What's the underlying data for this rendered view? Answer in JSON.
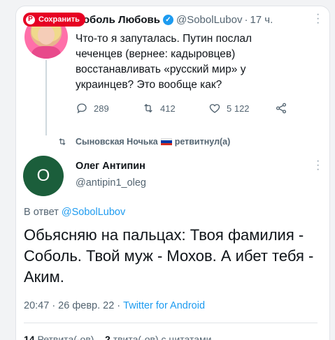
{
  "pin_button": {
    "label": "Сохранить",
    "icon": "pinterest-icon"
  },
  "tweet1": {
    "name": "Соболь Любовь",
    "handle": "@SobolLubov",
    "separator": "·",
    "time": "17 ч.",
    "text": "Что-то я запуталась. Путин послал чеченцев (вернее: кадыровцев) восстанавливать «русский мир» у украинцев? Это вообще как?",
    "replies": "289",
    "retweets": "412",
    "likes": "5 122"
  },
  "retweet_notice": {
    "user": "Сыновская Ночька",
    "suffix": "ретвитнул(а)",
    "flag_colors": [
      "#ffffff",
      "#0039a6",
      "#d52b1e"
    ]
  },
  "tweet2": {
    "avatar_letter": "О",
    "avatar_color": "#1b5e3b",
    "name": "Олег Антипин",
    "handle": "@antipin1_oleg",
    "reply_prefix": "В ответ",
    "reply_mention": "@SobolLubov",
    "text": "Обьясняю на пальцах: Твоя фамилия - Соболь. Твой муж - Мохов. А ибет тебя - Аким.",
    "timestamp": "20:47 · 26 февр. 22 ·",
    "source": "Twitter for Android"
  },
  "stats_row": {
    "retweets_count": "14",
    "retweets_label": "Ретвита(-ов)",
    "quotes_count": "2",
    "quotes_label": "твита(-ов) с цитатами"
  },
  "colors": {
    "accent": "#1d9bf0",
    "pin_red": "#e60023",
    "muted": "#536471"
  }
}
